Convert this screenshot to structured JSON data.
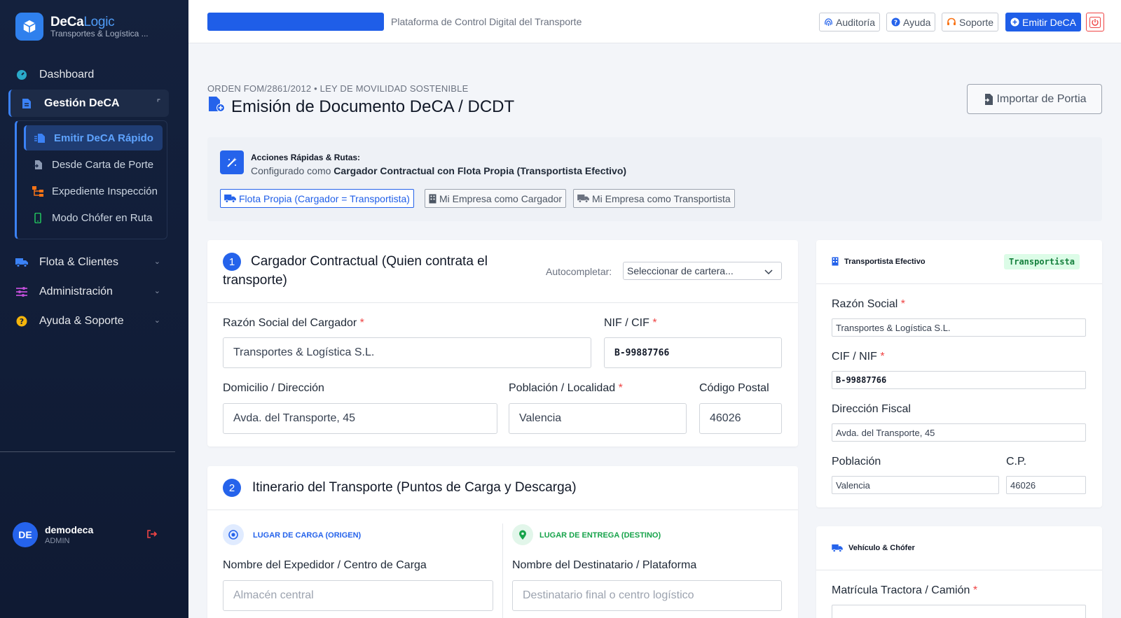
{
  "brand": {
    "name_a": "DeCa",
    "name_b": "Logic",
    "subtitle": "Transportes & Logística ..."
  },
  "sidebar": {
    "items": [
      {
        "label": "Dashboard"
      },
      {
        "label": "Gestión DeCA"
      },
      {
        "label": "Flota & Clientes"
      },
      {
        "label": "Administración"
      },
      {
        "label": "Ayuda & Soporte"
      }
    ],
    "subitems": [
      {
        "label": "Emitir DeCA Rápido"
      },
      {
        "label": "Desde Carta de Porte"
      },
      {
        "label": "Expediente Inspección"
      },
      {
        "label": "Modo Chófer en Ruta"
      }
    ]
  },
  "user": {
    "initials": "DE",
    "name": "demodeca",
    "role": "ADMIN"
  },
  "topbar": {
    "subtitle": "Plataforma de Control Digital del Transporte",
    "buttons": {
      "audit": "Auditoría",
      "help": "Ayuda",
      "support": "Soporte",
      "emit": "Emitir DeCA"
    }
  },
  "page": {
    "eyebrow": "ORDEN FOM/2861/2012 • LEY DE MOVILIDAD SOSTENIBLE",
    "title": "Emisión de Documento DeCA / DCDT",
    "import_label": "Importar de Portia"
  },
  "quick": {
    "title": "Acciones Rápidas & Rutas:",
    "desc_prefix": "Configurado como ",
    "desc_bold": "Cargador Contractual con Flota Propia (Transportista Efectivo)",
    "buttons": [
      "Flota Propia (Cargador = Transportista)",
      "Mi Empresa como Cargador",
      "Mi Empresa como Transportista"
    ]
  },
  "section1": {
    "step": "1",
    "title": "Cargador Contractual (Quien contrata el transporte)",
    "autocomplete_label": "Autocompletar:",
    "autocomplete_value": "Seleccionar de cartera...",
    "fields": {
      "razon": {
        "label": "Razón Social del Cargador",
        "value": "Transportes & Logística S.L."
      },
      "nif": {
        "label": "NIF / CIF",
        "value": "B-99887766"
      },
      "domicilio": {
        "label": "Domicilio / Dirección",
        "value": "Avda. del Transporte, 45"
      },
      "poblacion": {
        "label": "Población / Localidad",
        "value": "Valencia"
      },
      "cp": {
        "label": "Código Postal",
        "value": "46026"
      }
    }
  },
  "section2": {
    "step": "2",
    "title": "Itinerario del Transporte (Puntos de Carga y Descarga)",
    "origin": {
      "tag": "LUGAR DE CARGA (ORIGEN)",
      "label": "Nombre del Expedidor / Centro de Carga",
      "placeholder": "Almacén central"
    },
    "dest": {
      "tag": "LUGAR DE ENTREGA (DESTINO)",
      "label": "Nombre del Destinatario / Plataforma",
      "placeholder": "Destinatario final o centro logístico"
    }
  },
  "carrier": {
    "title": "Transportista Efectivo",
    "badge": "Transportista",
    "razon": {
      "label": "Razón Social",
      "value": "Transportes & Logística S.L."
    },
    "cif": {
      "label": "CIF / NIF",
      "value": "B-99887766"
    },
    "direccion": {
      "label": "Dirección Fiscal",
      "value": "Avda. del Transporte, 45"
    },
    "poblacion": {
      "label": "Población",
      "value": "Valencia"
    },
    "cp": {
      "label": "C.P.",
      "value": "46026"
    }
  },
  "vehicle": {
    "title": "Vehículo & Chófer",
    "matricula": {
      "label": "Matrícula Tractora / Camión"
    }
  },
  "colors": {
    "accent": "#2563eb",
    "sidebar_bg": "#14213d",
    "success": "#16a34a",
    "danger": "#ef4444"
  }
}
